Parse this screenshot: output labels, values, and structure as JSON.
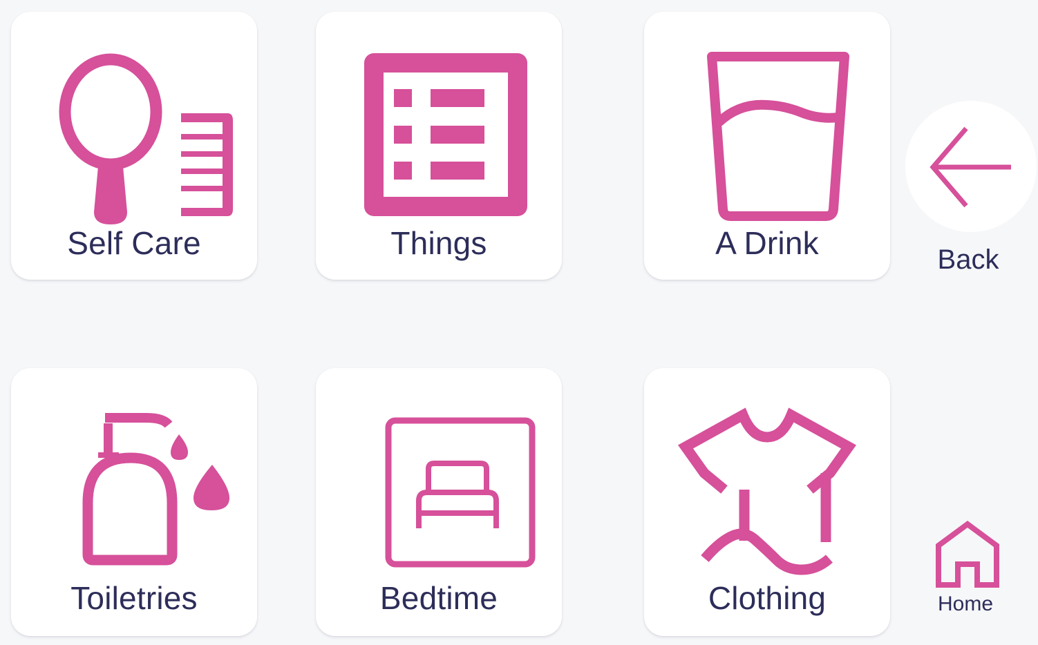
{
  "accent_color": "#d6509a",
  "text_color": "#2d2d5a",
  "tiles": [
    {
      "label": "Self Care",
      "icon": "mirror-comb-icon"
    },
    {
      "label": "Things",
      "icon": "list-icon"
    },
    {
      "label": "A Drink",
      "icon": "glass-of-water-icon"
    },
    {
      "label": "Toiletries",
      "icon": "soap-dispenser-icon"
    },
    {
      "label": "Bedtime",
      "icon": "bed-icon"
    },
    {
      "label": "Clothing",
      "icon": "clothing-icon"
    }
  ],
  "nav": {
    "back_label": "Back",
    "back_icon": "arrow-left-icon",
    "home_label": "Home",
    "home_icon": "home-icon"
  }
}
